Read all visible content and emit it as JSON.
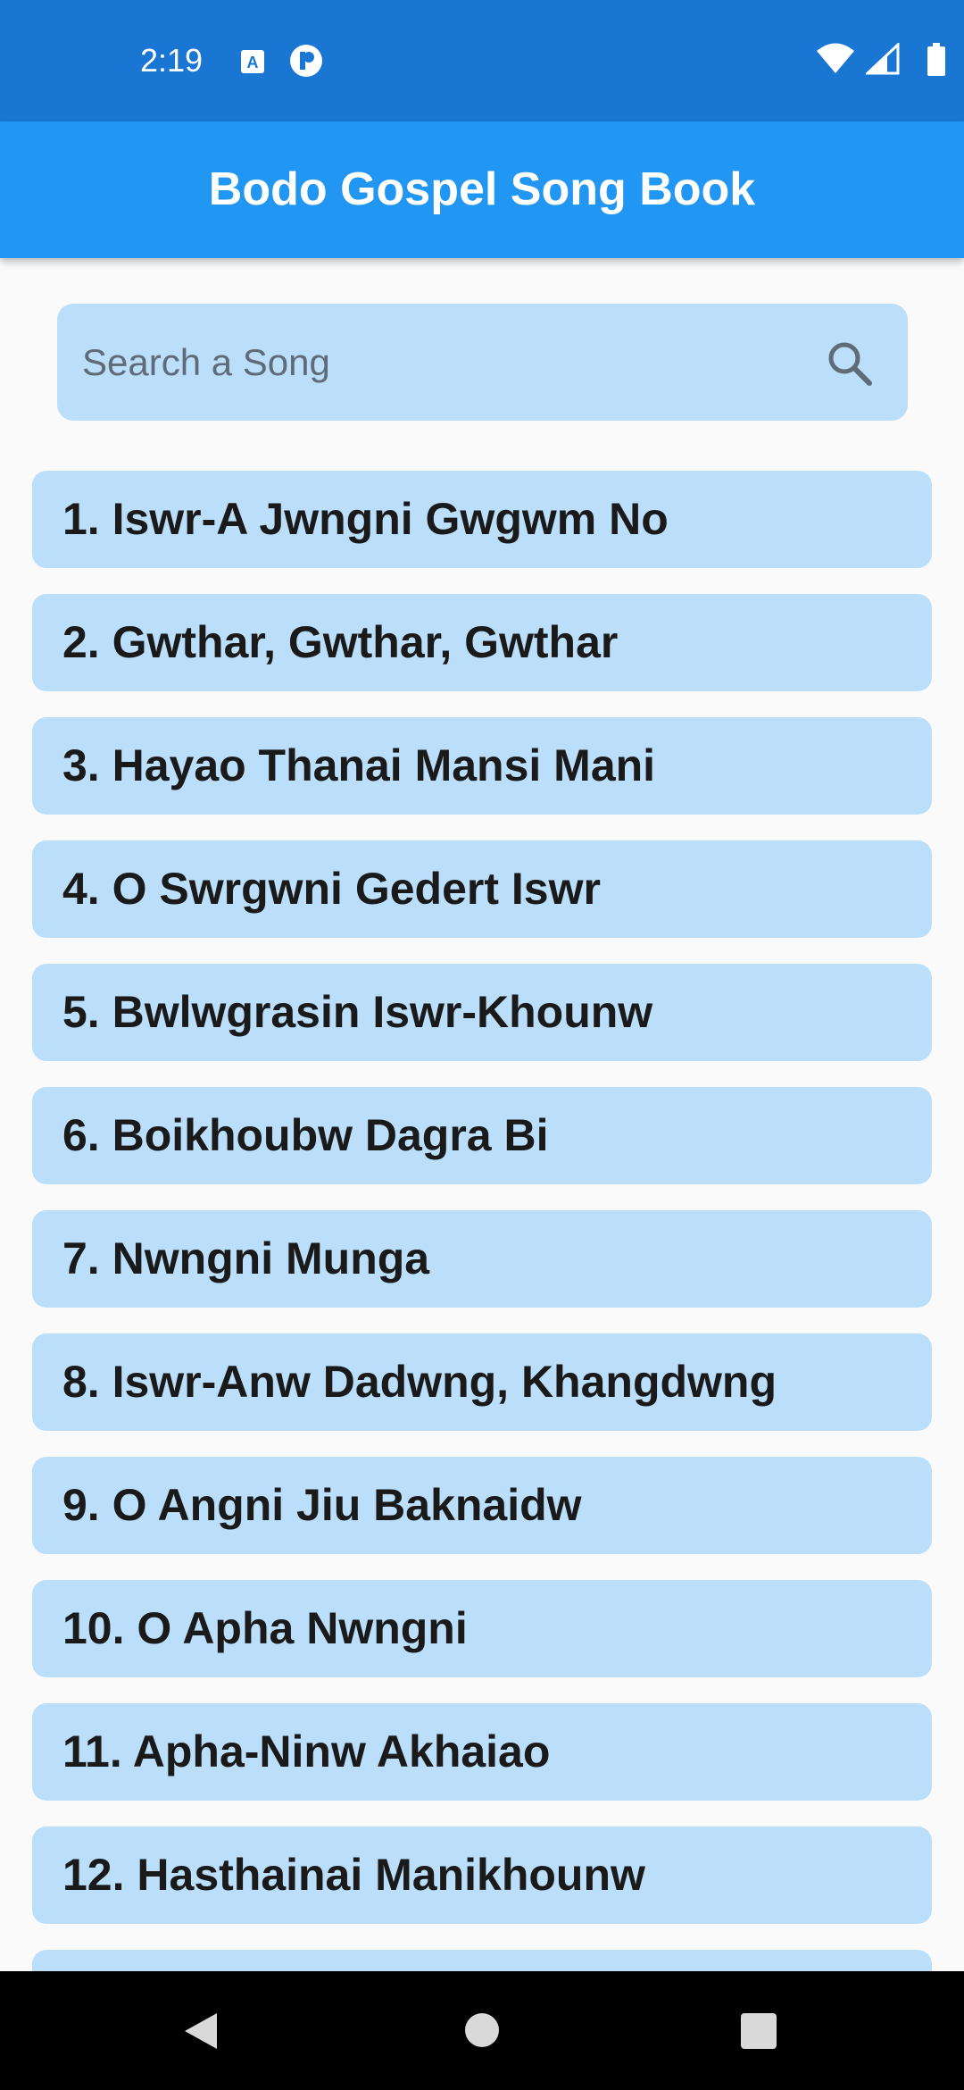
{
  "status_bar": {
    "time": "2:19",
    "icons": [
      "text-a-icon",
      "p-circle-icon",
      "wifi-icon",
      "signal-icon",
      "battery-icon"
    ]
  },
  "app_bar": {
    "title": "Bodo Gospel Song Book"
  },
  "search": {
    "placeholder": "Search a Song",
    "icon": "search-icon"
  },
  "songs": [
    {
      "label": "1. Iswr-A Jwngni Gwgwm No"
    },
    {
      "label": "2. Gwthar, Gwthar, Gwthar"
    },
    {
      "label": "3. Hayao Thanai Mansi Mani"
    },
    {
      "label": "4. O Swrgwni Gedert Iswr"
    },
    {
      "label": "5. Bwlwgrasin Iswr-Khounw"
    },
    {
      "label": "6. Boikhoubw Dagra Bi"
    },
    {
      "label": "7. Nwngni Munga"
    },
    {
      "label": "8. Iswr-Anw Dadwng, Khangdwng"
    },
    {
      "label": "9. O Angni Jiu Baknaidw"
    },
    {
      "label": "10. O Apha Nwngni"
    },
    {
      "label": "11. Apha-Ninw Akhaiao"
    },
    {
      "label": "12. Hasthainai Manikhounw"
    },
    {
      "label": ""
    }
  ],
  "colors": {
    "status_bar": "#1976d2",
    "app_bar": "#2196f3",
    "item_background": "#bbdefb",
    "page_background": "#fafafa",
    "nav_bar": "#000000"
  },
  "nav_bar": {
    "icons": [
      "back-icon",
      "home-icon",
      "recents-icon"
    ]
  }
}
